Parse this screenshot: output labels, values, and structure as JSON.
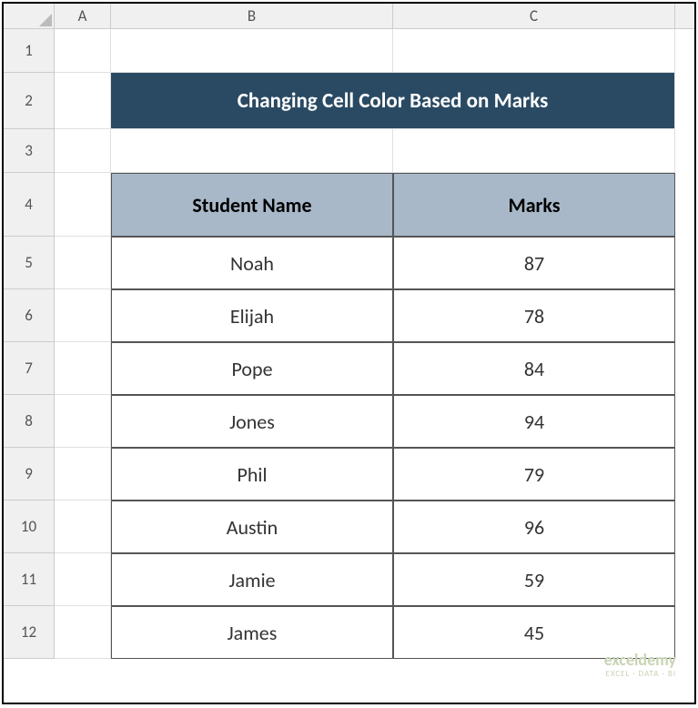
{
  "columns": {
    "A": "A",
    "B": "B",
    "C": "C"
  },
  "rows": [
    "1",
    "2",
    "3",
    "4",
    "5",
    "6",
    "7",
    "8",
    "9",
    "10",
    "11",
    "12"
  ],
  "title": "Changing Cell Color Based on Marks",
  "headers": {
    "name": "Student Name",
    "marks": "Marks"
  },
  "students": [
    {
      "name": "Noah",
      "marks": "87"
    },
    {
      "name": "Elijah",
      "marks": "78"
    },
    {
      "name": "Pope",
      "marks": "84"
    },
    {
      "name": "Jones",
      "marks": "94"
    },
    {
      "name": "Phil",
      "marks": "79"
    },
    {
      "name": "Austin",
      "marks": "96"
    },
    {
      "name": "Jamie",
      "marks": "59"
    },
    {
      "name": "James",
      "marks": "45"
    }
  ],
  "watermark": {
    "line1": "exceldemy",
    "line2": "EXCEL · DATA · BI"
  },
  "chart_data": {
    "type": "table",
    "title": "Changing Cell Color Based on Marks",
    "columns": [
      "Student Name",
      "Marks"
    ],
    "rows": [
      [
        "Noah",
        87
      ],
      [
        "Elijah",
        78
      ],
      [
        "Pope",
        84
      ],
      [
        "Jones",
        94
      ],
      [
        "Phil",
        79
      ],
      [
        "Austin",
        96
      ],
      [
        "Jamie",
        59
      ],
      [
        "James",
        45
      ]
    ]
  }
}
